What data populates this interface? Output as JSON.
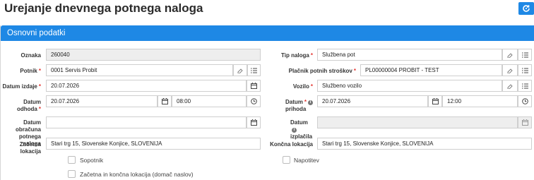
{
  "page": {
    "title": "Urejanje dnevnega potnega naloga"
  },
  "header": {
    "refresh_icon": "refresh-icon"
  },
  "section": {
    "title": "Osnovni podatki"
  },
  "left": {
    "oznaka": {
      "label": "Oznaka",
      "value": "260040"
    },
    "potnik": {
      "label": "Potnik",
      "value": "0001 Servis Probit"
    },
    "datum_izdaje": {
      "label": "Datum izdaje",
      "value": "20.07.2026"
    },
    "datum_odhoda": {
      "label": "Datum odhoda",
      "date": "20.07.2026",
      "time": "08:00"
    },
    "datum_obracuna": {
      "label_line1": "Datum obračuna",
      "label_line2": "potnega naloga",
      "value": ""
    },
    "zacetna_lokacija": {
      "label": "Začetna lokacija",
      "value": "Stari trg 15, Slovenske Konjice, SLOVENIJA"
    },
    "sopotnik": {
      "label": "Sopotnik",
      "checked": false
    },
    "zacetna_koncna": {
      "label": "Začetna in končna lokacija (domač naslov)",
      "checked": false
    }
  },
  "right": {
    "tip_naloga": {
      "label": "Tip naloga",
      "value": "Službena pot"
    },
    "placnik": {
      "label": "Plačnik potnih stroškov",
      "value": "PL00000004 PROBIT - TEST"
    },
    "vozilo": {
      "label": "Vozilo",
      "value": "Službeno vozilo"
    },
    "datum_prihoda": {
      "label_line1": "Datum",
      "label_line2": "prihoda",
      "date": "20.07.2026",
      "time": "12:00"
    },
    "datum_izplacila": {
      "label_line1": "Datum",
      "label_line2": "izplačila",
      "value": ""
    },
    "koncna_lokacija": {
      "label": "Končna lokacija",
      "value": "Stari trg 15, Slovenske Konjice, SLOVENIJA"
    },
    "napotitev": {
      "label": "Napotitev",
      "checked": false
    }
  },
  "colors": {
    "accent": "#1e88e5",
    "required": "#e53935",
    "readonly_bg": "#eeeeee"
  }
}
